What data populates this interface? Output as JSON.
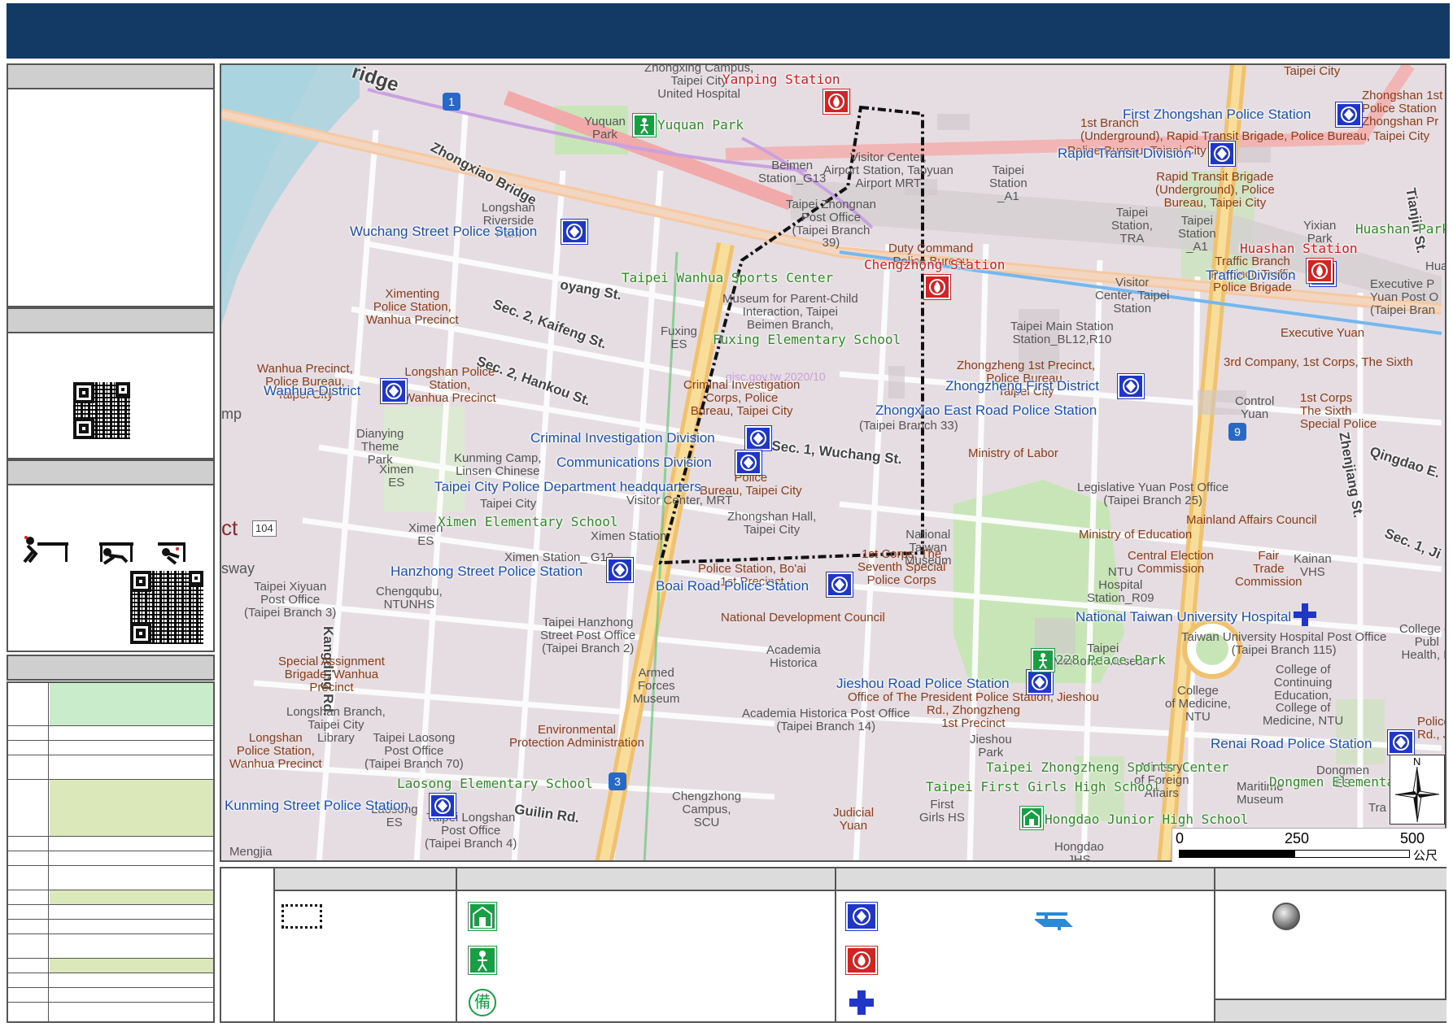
{
  "map": {
    "labels": {
      "police": [
        {
          "id": "wuchang",
          "text": "Wuchang Street Police Station"
        },
        {
          "id": "first-zhongshan",
          "text": "First Zhongshan Police Station"
        },
        {
          "id": "rapid-transit",
          "text": "Rapid Transit Division"
        },
        {
          "id": "traffic",
          "text": "Traffic Division"
        },
        {
          "id": "wanhua-district",
          "text": "Wanhua District"
        },
        {
          "id": "zhongzheng-first",
          "text": "Zhongzheng First District"
        },
        {
          "id": "zhongxiao-east",
          "text": "Zhongxiao East Road Police Station"
        },
        {
          "id": "criminal-investigation",
          "text": "Criminal Investigation Division"
        },
        {
          "id": "communications",
          "text": "Communications Division"
        },
        {
          "id": "tcpd-hq",
          "text": "Taipei City Police Department headquarters"
        },
        {
          "id": "hanzhong",
          "text": "Hanzhong Street Police Station"
        },
        {
          "id": "boai",
          "text": "Boai Road Police Station"
        },
        {
          "id": "jieshou",
          "text": "Jieshou Road Police Station"
        },
        {
          "id": "renai",
          "text": "Renai Road Police Station"
        },
        {
          "id": "kunming",
          "text": "Kunming Street Police Station"
        },
        {
          "id": "ntuh",
          "text": "National Taiwan University Hospital"
        }
      ],
      "fire": [
        {
          "id": "yanping",
          "text": "Yanping Station"
        },
        {
          "id": "chengzhong",
          "text": "Chengzhong Station"
        },
        {
          "id": "huashan",
          "text": "Huashan Station"
        }
      ],
      "shelters": [
        {
          "id": "yuquan",
          "text": "Yuquan Park"
        },
        {
          "id": "wanhua-sports",
          "text": "Taipei Wanhua Sports Center"
        },
        {
          "id": "fuxing-es",
          "text": "Fuxing Elementary School"
        },
        {
          "id": "ximen-es",
          "text": "Ximen Elementary School"
        },
        {
          "id": "huashan-park",
          "text": "Huashan Park"
        },
        {
          "id": "peace-park",
          "text": "228 Peace Park"
        },
        {
          "id": "zhongzheng-sports",
          "text": "Taipei Zhongzheng Sports Center"
        },
        {
          "id": "first-girls",
          "text": "Taipei First Girls High School"
        },
        {
          "id": "dongmen-es",
          "text": "Dongmen Elementary"
        },
        {
          "id": "laosong-es",
          "text": "Laosong Elementary School"
        },
        {
          "id": "hongdao",
          "text": "Hongdao Junior High School"
        }
      ],
      "base": [
        {
          "id": "b1",
          "text": "Zhongxing Campus,\nTaipei City\nUnited Hospital"
        },
        {
          "id": "b2",
          "text": "Yuquan\nPark"
        },
        {
          "id": "b3",
          "text": "Beimen\nStation_G13"
        },
        {
          "id": "b4",
          "text": "Visitor Center,\nAirport Station, Taoyuan\nAirport MRT"
        },
        {
          "id": "b5",
          "text": "Taipei\nStation\n_A1"
        },
        {
          "id": "b6",
          "text": "Taipei Zhongnan\nPost Office\n(Taipei Branch\n39)"
        },
        {
          "id": "b7",
          "text": "Duty Command\nPolice Bureau"
        },
        {
          "id": "b8",
          "text": "1st Branch\n(Underground), Rapid Transit Brigade, Police Bureau, Taipei City"
        },
        {
          "id": "b9",
          "text": "Taipei City"
        },
        {
          "id": "b10",
          "text": "Zhongshan 1st\nPolice Station\nZhongshan Pr"
        },
        {
          "id": "b11",
          "text": "Rapid Transit Brigade\n(Underground), Police\nBureau, Taipei City"
        },
        {
          "id": "b12",
          "text": "Taipei\nStation,\nTRA"
        },
        {
          "id": "b13",
          "text": "Yixian\nPark"
        },
        {
          "id": "b14",
          "text": "Traffic Branch\nPrecinct, Traffic\nPolice Brigade"
        },
        {
          "id": "b15",
          "text": "Executive P\nYuan Post O\n(Taipei Bran"
        },
        {
          "id": "b16",
          "text": "Visitor\nCenter, Taipei\nStation"
        },
        {
          "id": "b17",
          "text": "Taipei Main Station\nStation_BL12,R10"
        },
        {
          "id": "b18",
          "text": "Executive Yuan"
        },
        {
          "id": "b19",
          "text": "3rd Company, 1st Corps, The Sixth"
        },
        {
          "id": "b20",
          "text": "Longshan\nRiverside\nPark"
        },
        {
          "id": "b21",
          "text": "Ximenting\nPolice Station,\nWanhua Precinct"
        },
        {
          "id": "b22",
          "text": "Museum for Parent-Child\nInteraction, Taipei\nBeimen Branch,"
        },
        {
          "id": "b23",
          "text": "Fuxing\nES"
        },
        {
          "id": "b24",
          "text": "Wanhua Precinct,\nPolice Bureau,\nTaipei City"
        },
        {
          "id": "b25",
          "text": "Longshan Police\nStation,\nWanhua Precinct"
        },
        {
          "id": "b26",
          "text": "Criminal Investigation\nCorps, Police\nBureau, Taipei City"
        },
        {
          "id": "b27",
          "text": "Zhongzheng 1st Precinct,\nPolice Bureau,\nTaipei City"
        },
        {
          "id": "b28",
          "text": "(Taipei Branch 33)"
        },
        {
          "id": "b29",
          "text": "1st Corps\nThe Sixth\nSpecial Police"
        },
        {
          "id": "b30",
          "text": "Control\nYuan"
        },
        {
          "id": "b31",
          "text": "Dianying\nTheme\nPark"
        },
        {
          "id": "b32",
          "text": "Kunming Camp,\nLinsen Chinese"
        },
        {
          "id": "b33",
          "text": "Ministry of Labor"
        },
        {
          "id": "b34",
          "text": "Legislative Yuan Post Office\n(Taipei Branch 25)"
        },
        {
          "id": "b35",
          "text": "Mainland Affairs Council"
        },
        {
          "id": "b36",
          "text": "Taipei City"
        },
        {
          "id": "b37",
          "text": "Ximen\nES"
        },
        {
          "id": "b38",
          "text": "Police\nBureau, Taipei City"
        },
        {
          "id": "b39",
          "text": "Zhongshan Hall,\nTaipei City"
        },
        {
          "id": "b40",
          "text": "Ximen Station"
        },
        {
          "id": "b41",
          "text": "National\nTaiwan\nMuseum"
        },
        {
          "id": "b42",
          "text": "Ministry of Education"
        },
        {
          "id": "b43",
          "text": "NTU\nHospital\nStation_R09"
        },
        {
          "id": "b44",
          "text": "Central Election\nCommission"
        },
        {
          "id": "b45",
          "text": "Fair\nTrade\nCommission"
        },
        {
          "id": "b46",
          "text": "Kainan\nVHS"
        },
        {
          "id": "b47",
          "text": "Ximen Station_ G12"
        },
        {
          "id": "b48",
          "text": "Police Station, Bo'ai\n1st Precinct"
        },
        {
          "id": "b49",
          "text": "1st Corps, The\nSeventh Special\nPolice Corps"
        },
        {
          "id": "b50",
          "text": "National Development Council"
        },
        {
          "id": "b51",
          "text": "Taipei Xiyuan\nPost Office\n(Taipei Branch 3)"
        },
        {
          "id": "b52",
          "text": "Chengqubu,\nNTUNHS"
        },
        {
          "id": "b53",
          "text": "Taipei Hanzhong\nStreet Post Office\n(Taipei Branch 2)"
        },
        {
          "id": "b54",
          "text": "Academia\nHistorica"
        },
        {
          "id": "b55",
          "text": "Taiwan University Hospital Post Office\n(Taipei Branch 115)"
        },
        {
          "id": "b56",
          "text": "College of\nPubl\nHealth, N"
        },
        {
          "id": "b57",
          "text": "Special Assignment\nBrigade, Wanhua\nPrecinct"
        },
        {
          "id": "b58",
          "text": "Armed\nForces\nMuseum"
        },
        {
          "id": "b59",
          "text": "Taipei\nMemorial Museum"
        },
        {
          "id": "b60",
          "text": "Office of The President Police Station, Jieshou\nRd., Zhongzheng\n1st Precinct"
        },
        {
          "id": "b61",
          "text": "College of\nContinuing\nEducation,\nCollege of\nMedicine, NTU"
        },
        {
          "id": "b62",
          "text": "College\nof Medicine,\nNTU"
        },
        {
          "id": "b63",
          "text": "Longshan Branch,\nTaipei City\nLibrary"
        },
        {
          "id": "b64",
          "text": "Taipei Laosong\nPost Office\n(Taipei Branch 70)"
        },
        {
          "id": "b65",
          "text": "Environmental\nProtection Administration"
        },
        {
          "id": "b66",
          "text": "Academia Historica Post Office\n(Taipei Branch 14)"
        },
        {
          "id": "b67",
          "text": "Longshan\nPolice Station,\nWanhua Precinct"
        },
        {
          "id": "b68",
          "text": "Police\nRd., J"
        },
        {
          "id": "b69",
          "text": "Jieshou\nPark"
        },
        {
          "id": "b70",
          "text": "Ministry\nof Foreign\nAffairs"
        },
        {
          "id": "b71",
          "text": "Maritime\nMuseum"
        },
        {
          "id": "b72",
          "text": "Dongmen\nES"
        },
        {
          "id": "b73",
          "text": "Chengzhong\nCampus,\nSCU"
        },
        {
          "id": "b74",
          "text": "Judicial\nYuan"
        },
        {
          "id": "b75",
          "text": "First\nGirls HS"
        },
        {
          "id": "b76",
          "text": "Laosong\nES"
        },
        {
          "id": "b77",
          "text": "Taipei Longshan\nPost Office\n(Taipei Branch 4)"
        },
        {
          "id": "b78",
          "text": "Hongdao\nJHS"
        },
        {
          "id": "b79",
          "text": "Mengjia"
        },
        {
          "id": "b80",
          "text": "Ximen\nES"
        },
        {
          "id": "b81",
          "text": "Visitor Center, MRT"
        },
        {
          "id": "b82",
          "text": "Tra"
        },
        {
          "id": "b83",
          "text": "Hua"
        },
        {
          "id": "b84",
          "text": "Police Bureau, Taipei City"
        },
        {
          "id": "b85",
          "text": "ct"
        },
        {
          "id": "b86",
          "text": "mp"
        },
        {
          "id": "b87",
          "text": "sway"
        },
        {
          "id": "b88",
          "text": "Taipei\nStation\n_A1"
        }
      ],
      "roads": [
        {
          "id": "r1",
          "text": "Zhongxiao Bridge"
        },
        {
          "id": "r2",
          "text": "ridge"
        },
        {
          "id": "r3",
          "text": "Sec. 2, Kaifeng St."
        },
        {
          "id": "r4",
          "text": "Sec. 2, Hankou St."
        },
        {
          "id": "r5",
          "text": "Sec. 1, Wuchang St."
        },
        {
          "id": "r6",
          "text": "Kangding Rd."
        },
        {
          "id": "r7",
          "text": "Guilin Rd."
        },
        {
          "id": "r8",
          "text": "Qingdao E."
        },
        {
          "id": "r9",
          "text": "Tianjin St."
        },
        {
          "id": "r10",
          "text": "Zhenjiang St."
        },
        {
          "id": "r11",
          "text": "Sec. 1, Ji"
        },
        {
          "id": "r12",
          "text": "oyang St."
        }
      ],
      "shields": [
        {
          "id": "s1",
          "text": "1"
        },
        {
          "id": "s2",
          "text": "9"
        },
        {
          "id": "s3",
          "text": "3"
        },
        {
          "id": "s4",
          "text": "104"
        }
      ]
    },
    "watermark": "gisc.gov.tw 2020/10"
  },
  "scalebar": {
    "ticks": [
      "0",
      "250",
      "500"
    ],
    "unit": "公尺"
  },
  "compass": {
    "north": "N"
  },
  "colors": {
    "header": "#123a64",
    "police_icon": "#1f36c7",
    "fire_icon": "#d32424",
    "shelter_icon": "#17a043",
    "police_label": "#1a4fb5",
    "fire_label": "#d21a1a",
    "shelter_label": "#2f8a25",
    "river": "#aad3df",
    "park": "#c8e5b8",
    "highlight_green": "#c9eccb",
    "highlight_olive": "#dbe8b9"
  }
}
